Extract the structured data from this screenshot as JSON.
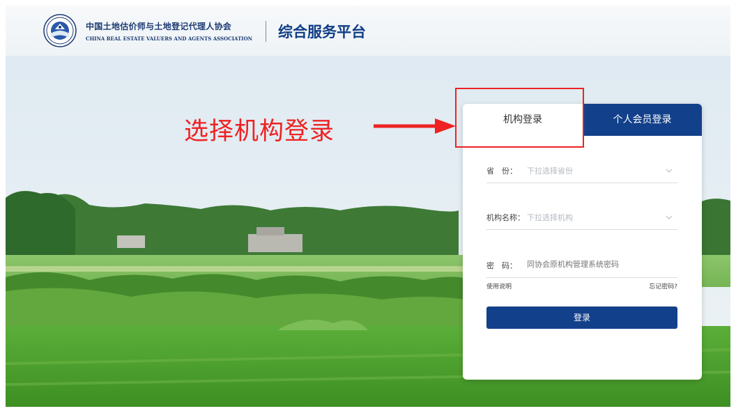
{
  "header": {
    "org_name_cn": "中国土地估价师与土地登记代理人协会",
    "org_name_en": "CHINA REAL ESTATE VALUERS AND AGENTS ASSOCIATION",
    "platform_title": "综合服务平台"
  },
  "annotation": {
    "text": "选择机构登录",
    "color": "#ee2222"
  },
  "login": {
    "tabs": [
      {
        "label": "机构登录",
        "active": true
      },
      {
        "label": "个人会员登录",
        "active": false
      }
    ],
    "fields": {
      "province": {
        "label": "省　份：",
        "placeholder": "下拉选择省份"
      },
      "org": {
        "label": "机构名称：",
        "placeholder": "下拉选择机构"
      },
      "password": {
        "label": "密　码：",
        "placeholder": "同协会原机构管理系统密码"
      }
    },
    "help_link": "使用说明",
    "forgot_link": "忘记密码?",
    "submit_label": "登录"
  },
  "colors": {
    "brand": "#13408a",
    "annotation": "#ee2222"
  },
  "icons": {
    "logo": "association-seal-icon",
    "dropdown": "chevron-down-icon",
    "annotation": "arrow-right-icon"
  }
}
